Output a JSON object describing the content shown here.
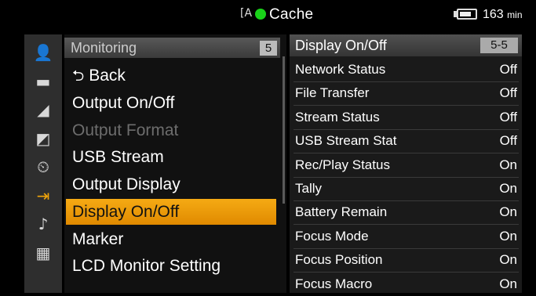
{
  "status_bar": {
    "media_icon": "card-slot-a-icon",
    "cache_label": "Cache",
    "cache_color": "#19d219",
    "battery_icon": "battery-icon",
    "battery_level": 0.8,
    "battery_minutes": "163",
    "battery_unit": "min"
  },
  "side_icons": [
    {
      "name": "user-settings-icon",
      "glyph": "👤",
      "active": false
    },
    {
      "name": "camera-icon",
      "glyph": "▬",
      "active": false
    },
    {
      "name": "clapperboard-icon",
      "glyph": "◢",
      "active": false
    },
    {
      "name": "scene-file-icon",
      "glyph": "◩",
      "active": false
    },
    {
      "name": "timecode-icon",
      "glyph": "⏲",
      "active": false
    },
    {
      "name": "output-icon",
      "glyph": "⇥",
      "active": true
    },
    {
      "name": "audio-icon",
      "glyph": "♪",
      "active": false
    },
    {
      "name": "system-icon",
      "glyph": "▦",
      "active": false
    }
  ],
  "menu": {
    "title": "Monitoring",
    "page": "5",
    "back_label": "Back",
    "items": [
      {
        "label": "Output On/Off",
        "state": "normal"
      },
      {
        "label": "Output Format",
        "state": "disabled"
      },
      {
        "label": "USB Stream",
        "state": "normal"
      },
      {
        "label": "Output Display",
        "state": "normal"
      },
      {
        "label": "Display On/Off",
        "state": "selected"
      },
      {
        "label": "Marker",
        "state": "normal"
      },
      {
        "label": "LCD Monitor Setting",
        "state": "normal"
      }
    ]
  },
  "detail": {
    "title": "Display On/Off",
    "page": "5-5",
    "rows": [
      {
        "label": "Network Status",
        "value": "Off"
      },
      {
        "label": "File Transfer",
        "value": "Off"
      },
      {
        "label": "Stream Status",
        "value": "Off"
      },
      {
        "label": "USB Stream Stat",
        "value": "Off"
      },
      {
        "label": "Rec/Play Status",
        "value": "On"
      },
      {
        "label": "Tally",
        "value": "On"
      },
      {
        "label": "Battery Remain",
        "value": "On"
      },
      {
        "label": "Focus Mode",
        "value": "On"
      },
      {
        "label": "Focus Position",
        "value": "On"
      },
      {
        "label": "Focus Macro",
        "value": "On"
      }
    ]
  },
  "colors": {
    "accent": "#f1a50a",
    "disabled_text": "#6d6d6d"
  }
}
